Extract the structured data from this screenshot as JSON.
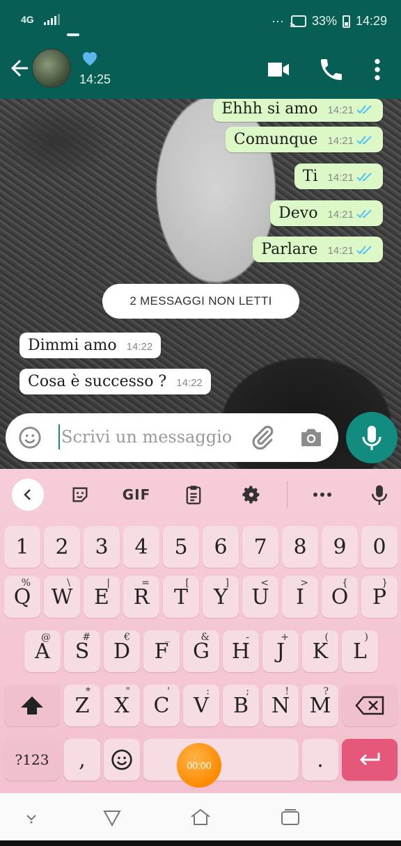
{
  "status_bar": {
    "network": "4G",
    "battery": "33%",
    "time": "14:29",
    "overflow": "···"
  },
  "header": {
    "contact_name_emoji": "blue-heart",
    "last_seen": "14:25"
  },
  "messages": [
    {
      "direction": "out",
      "text": "Ehhh si amo",
      "time": "14:21",
      "read": true
    },
    {
      "direction": "out",
      "text": "Comunque",
      "time": "14:21",
      "read": true
    },
    {
      "direction": "out",
      "text": "Ti",
      "time": "14:21",
      "read": true
    },
    {
      "direction": "out",
      "text": "Devo",
      "time": "14:21",
      "read": true
    },
    {
      "direction": "out",
      "text": "Parlare",
      "time": "14:21",
      "read": true
    },
    {
      "direction": "in",
      "text": "Dimmi amo",
      "time": "14:22"
    },
    {
      "direction": "in",
      "text": "Cosa è successo ?",
      "time": "14:22"
    }
  ],
  "unread_banner": "2 MESSAGGI NON LETTI",
  "composer": {
    "placeholder": "Scrivi un messaggio"
  },
  "keyboard": {
    "toolbar": {
      "gif": "GIF"
    },
    "number_row": [
      "1",
      "2",
      "3",
      "4",
      "5",
      "6",
      "7",
      "8",
      "9",
      "0"
    ],
    "row1": [
      {
        "k": "Q",
        "h": "%"
      },
      {
        "k": "W",
        "h": "\\"
      },
      {
        "k": "E",
        "h": "|"
      },
      {
        "k": "R",
        "h": "="
      },
      {
        "k": "T",
        "h": "["
      },
      {
        "k": "Y",
        "h": "]"
      },
      {
        "k": "U",
        "h": "<"
      },
      {
        "k": "I",
        "h": ">"
      },
      {
        "k": "O",
        "h": "{"
      },
      {
        "k": "P",
        "h": "}"
      }
    ],
    "row2": [
      {
        "k": "A",
        "h": "@"
      },
      {
        "k": "S",
        "h": "#"
      },
      {
        "k": "D",
        "h": "€"
      },
      {
        "k": "F",
        "h": "_"
      },
      {
        "k": "G",
        "h": "&"
      },
      {
        "k": "H",
        "h": "-"
      },
      {
        "k": "J",
        "h": "+"
      },
      {
        "k": "K",
        "h": "("
      },
      {
        "k": "L",
        "h": ")"
      }
    ],
    "row3": [
      {
        "k": "Z",
        "h": "*"
      },
      {
        "k": "X",
        "h": "\""
      },
      {
        "k": "C",
        "h": "'"
      },
      {
        "k": "V",
        "h": ":"
      },
      {
        "k": "B",
        "h": ";"
      },
      {
        "k": "N",
        "h": "!"
      },
      {
        "k": "M",
        "h": "?"
      }
    ],
    "symbols_label": "?123",
    "comma": ",",
    "period": ".",
    "timer": "00:00"
  },
  "colors": {
    "header_green": "#075e54",
    "fab_green": "#128c7e",
    "outgoing_bubble": "#dcf8c6",
    "read_tick": "#4fc3f7",
    "keyboard_pink": "#f6cdd8",
    "enter_key": "#e6577c"
  }
}
